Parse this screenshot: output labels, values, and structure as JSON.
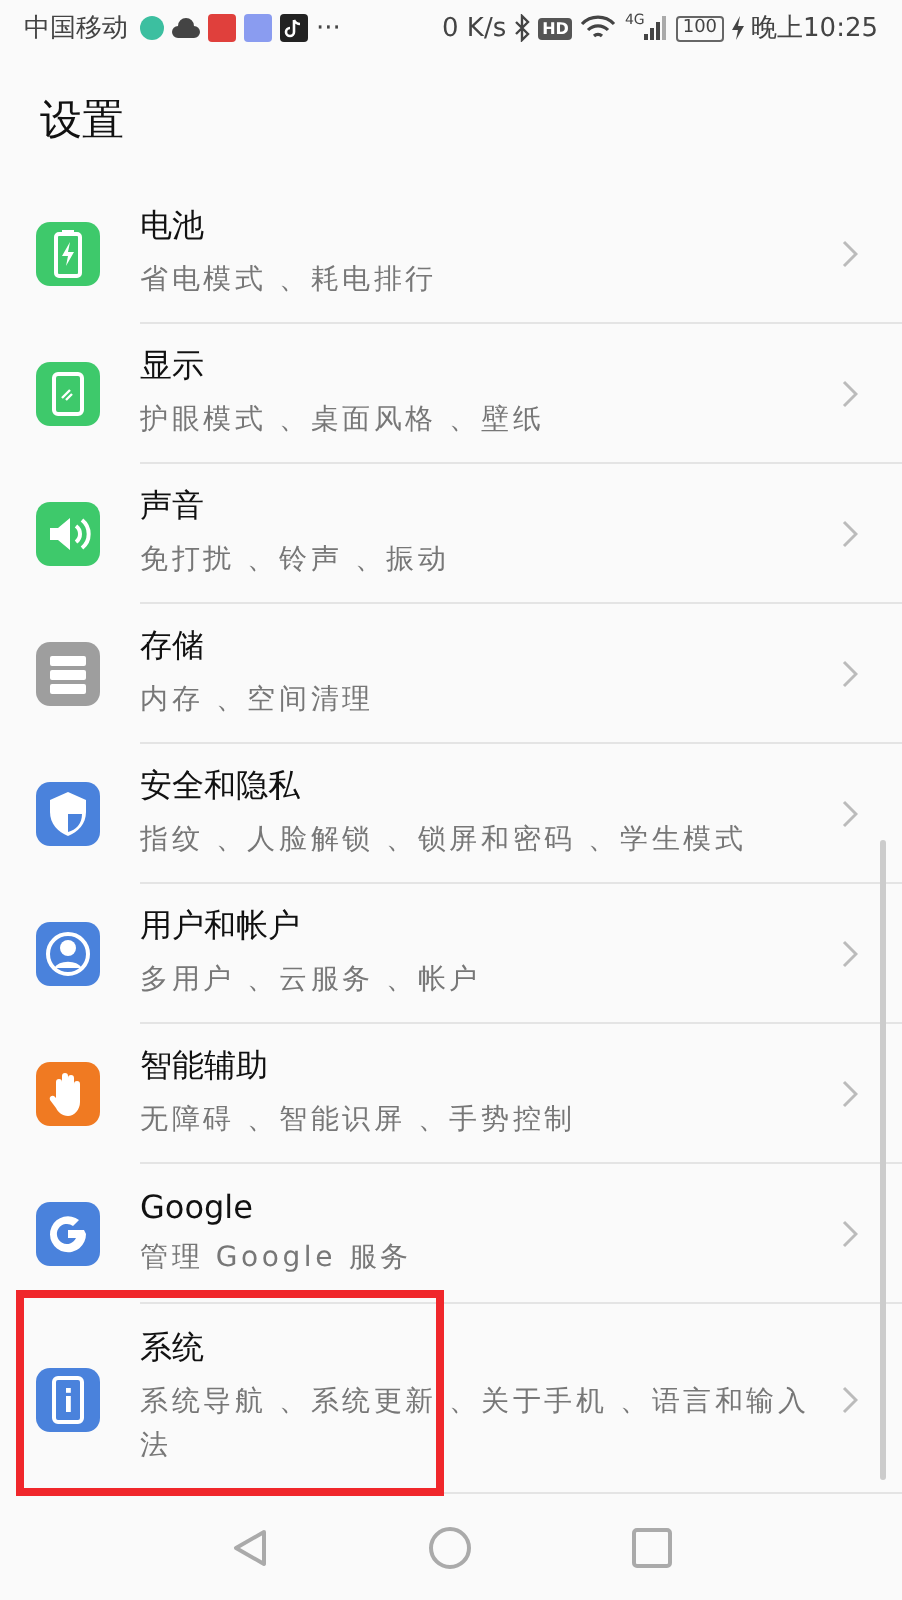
{
  "status_bar": {
    "carrier": "中国移动",
    "more": "···",
    "speed": "0 K/s",
    "hd": "HD",
    "network": "4G",
    "battery": "100",
    "time": "晚上10:25"
  },
  "header": {
    "title": "设置"
  },
  "items": [
    {
      "kind": "battery",
      "color": "#3ec96b",
      "title": "电池",
      "subtitle": "省电模式 、耗电排行",
      "highlighted": false
    },
    {
      "kind": "display",
      "color": "#3ec96b",
      "title": "显示",
      "subtitle": "护眼模式 、桌面风格 、壁纸",
      "highlighted": false
    },
    {
      "kind": "sound",
      "color": "#3ec96b",
      "title": "声音",
      "subtitle": "免打扰 、铃声 、振动",
      "highlighted": false
    },
    {
      "kind": "storage",
      "color": "#9e9e9e",
      "title": "存储",
      "subtitle": "内存 、空间清理",
      "highlighted": false
    },
    {
      "kind": "shield",
      "color": "#4a82dc",
      "title": "安全和隐私",
      "subtitle": "指纹 、人脸解锁 、锁屏和密码 、学生模式",
      "highlighted": false
    },
    {
      "kind": "user",
      "color": "#4a82dc",
      "title": "用户和帐户",
      "subtitle": "多用户 、云服务 、帐户",
      "highlighted": false
    },
    {
      "kind": "hand",
      "color": "#f07a22",
      "title": "智能辅助",
      "subtitle": "无障碍 、智能识屏 、手势控制",
      "highlighted": false
    },
    {
      "kind": "google",
      "color": "#4a82dc",
      "title": "Google",
      "subtitle": "管理 Google 服务",
      "highlighted": false
    },
    {
      "kind": "info",
      "color": "#4a82dc",
      "title": "系统",
      "subtitle": "系统导航 、系统更新 、关于手机 、语言和输入法",
      "highlighted": true
    }
  ]
}
